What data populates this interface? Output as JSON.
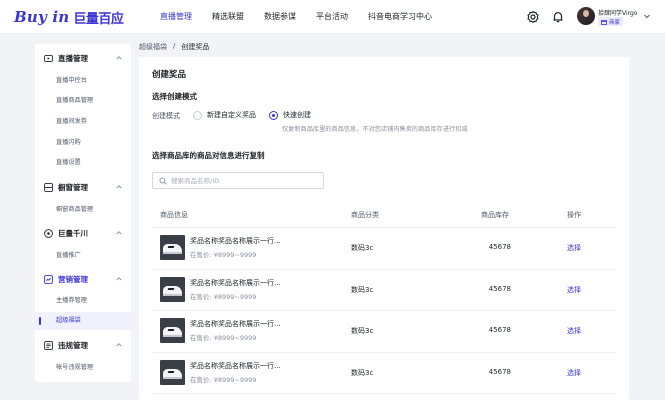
{
  "brand": {
    "logo_en": "Buy in",
    "logo_cn": "巨量百应"
  },
  "nav": [
    "直播管理",
    "精选联盟",
    "数据参谋",
    "平台活动",
    "抖音电商学习中心"
  ],
  "user": {
    "name": "拾肆同学Virgo",
    "role": "商家"
  },
  "sidebar": {
    "groups": [
      {
        "title": "直播管理",
        "icon": "live-icon",
        "items": [
          "直播中控台",
          "直播商品管理",
          "直播间发券",
          "直播闪购",
          "直播设置"
        ]
      },
      {
        "title": "橱窗管理",
        "icon": "window-icon",
        "items": [
          "橱窗商品管理"
        ]
      },
      {
        "title": "巨量千川",
        "icon": "qianchuan-icon",
        "items": [
          "直播推广"
        ]
      },
      {
        "title": "营销管理",
        "icon": "marketing-icon",
        "items": [
          "主播券管理",
          "超级福袋"
        ]
      },
      {
        "title": "违规管理",
        "icon": "violation-icon",
        "items": [
          "帐号违规管理"
        ]
      }
    ],
    "active_item": "超级福袋"
  },
  "breadcrumb": {
    "parent": "超级福袋",
    "separator": "/",
    "current": "创建奖品"
  },
  "card": {
    "title": "创建奖品",
    "mode_section": "选择创建模式",
    "mode_label": "创建模式",
    "options": [
      {
        "label": "新建自定义奖品",
        "checked": false
      },
      {
        "label": "快速创建",
        "checked": true
      }
    ],
    "hint": "仅复制商品库里的商品信息，不对您店铺内售卖的商品库存进行扣减",
    "copy_section": "选择商品库的商品对信息进行复制",
    "search_placeholder": "搜索商品名称/ID",
    "table": {
      "headers": [
        "商品信息",
        "商品分类",
        "商品库存",
        "操作"
      ],
      "rows": [
        {
          "name": "奖品名称奖品名称展示一行...",
          "price": "在售价: ¥8999~9999",
          "category": "数码3c",
          "stock": "45678",
          "action": "选择"
        },
        {
          "name": "奖品名称奖品名称展示一行...",
          "price": "在售价: ¥8999~9999",
          "category": "数码3c",
          "stock": "45678",
          "action": "选择"
        },
        {
          "name": "奖品名称奖品名称展示一行...",
          "price": "在售价: ¥8999~9999",
          "category": "数码3c",
          "stock": "45678",
          "action": "选择"
        },
        {
          "name": "奖品名称奖品名称展示一行...",
          "price": "在售价: ¥8999~9999",
          "category": "数码3c",
          "stock": "45678",
          "action": "选择"
        }
      ]
    }
  },
  "colors": {
    "accent": "#3b35d6",
    "background": "#f2f3f7",
    "muted": "#86909c"
  }
}
